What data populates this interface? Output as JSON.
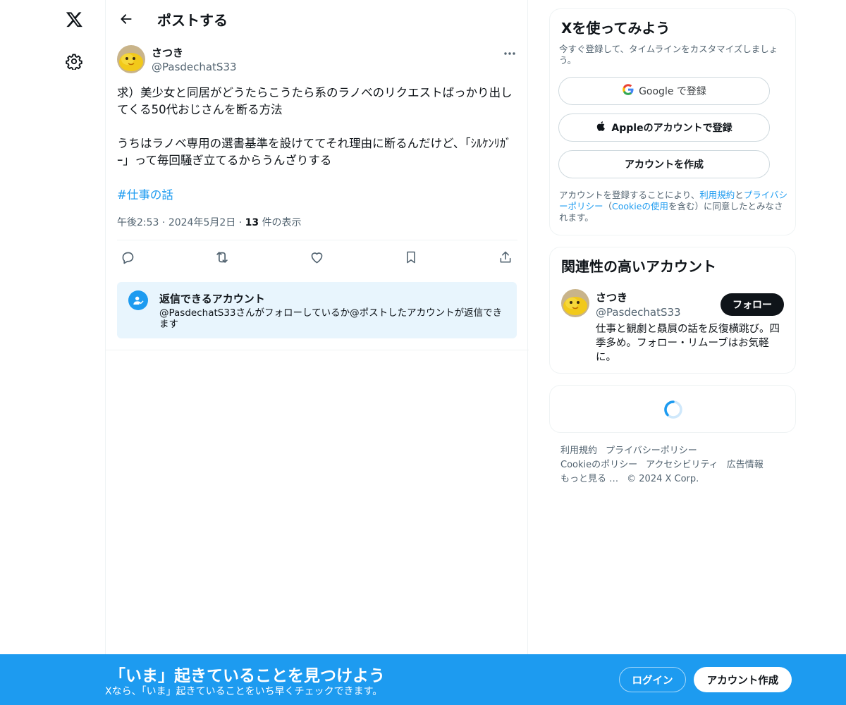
{
  "nav": {
    "logo_icon": "x-logo-icon",
    "settings_icon": "gear-icon"
  },
  "header": {
    "back_icon": "arrow-left-icon",
    "title": "ポストする"
  },
  "post": {
    "author": {
      "name": "さつき",
      "handle": "@PasdechatS33"
    },
    "paragraphs": [
      "求）美少女と同居がどうたらこうたら系のラノベのリクエストばっかり出してくる50代おじさんを断る方法",
      "うちはラノベ専用の選書基準を設けててそれ理由に断るんだけど、「ｼﾙｹﾝﾘｶﾞｰ」って毎回騒ぎ立てるからうんざりする"
    ],
    "hashtag": "#仕事の話",
    "time": "午後2:53",
    "date": "2024年5月2日",
    "separator": "·",
    "views_count": "13",
    "views_label": "件の表示",
    "actions": [
      "reply-icon",
      "repost-icon",
      "like-icon",
      "bookmark-icon",
      "share-icon"
    ]
  },
  "reply_restriction": {
    "title": "返信できるアカウント",
    "description": "@PasdechatS33さんがフォローしているか@ポストしたアカウントが返信できます"
  },
  "signup": {
    "title": "Xを使ってみよう",
    "subtitle": "今すぐ登録して、タイムラインをカスタマイズしましょう。",
    "google_label": "Google で登録",
    "apple_label": "Appleのアカウントで登録",
    "create_label": "アカウントを作成",
    "legal": {
      "part1": "アカウントを登録することにより、",
      "terms": "利用規約",
      "part2": "と",
      "privacy": "プライバシーポリシー",
      "part3": "（",
      "cookie": "Cookieの使用",
      "part4": "を含む）に同意したとみなされます。"
    }
  },
  "related": {
    "title": "関連性の高いアカウント",
    "name": "さつき",
    "handle": "@PasdechatS33",
    "follow_label": "フォロー",
    "bio": "仕事と観劇と贔屓の話を反復横跳び。四季多め。フォロー・リムーブはお気軽に。"
  },
  "footer": {
    "terms": "利用規約",
    "privacy": "プライバシーポリシー",
    "cookie": "Cookieのポリシー",
    "accessibility": "アクセシビリティ",
    "ads": "広告情報",
    "more": "もっと見る …",
    "copyright": "© 2024 X Corp."
  },
  "banner": {
    "title": "「いま」起きていることを見つけよう",
    "subtitle": "Xなら、「いま」起きていることをいち早くチェックできます。",
    "login_label": "ログイン",
    "create_label": "アカウント作成"
  },
  "colors": {
    "accent": "#1d9bf0",
    "text": "#0f1419",
    "muted": "#536471",
    "reply_bg": "#e8f5fd"
  }
}
